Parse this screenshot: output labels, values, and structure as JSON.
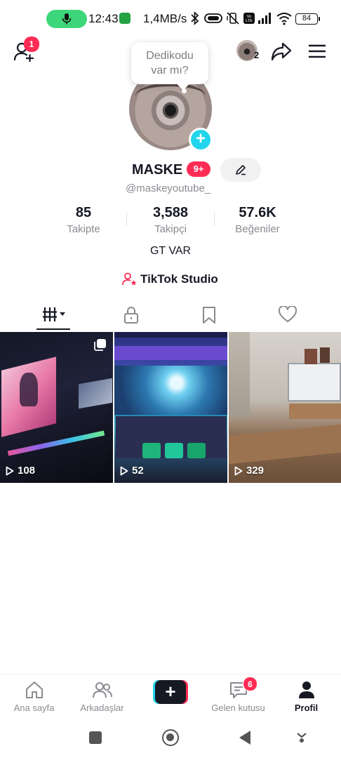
{
  "status_bar": {
    "time": "12:43",
    "network_speed": "1,4MB/s",
    "battery": "84"
  },
  "header": {
    "friends_badge": "1",
    "story_count": "2"
  },
  "profile": {
    "note_bubble_line1": "Dedikodu",
    "note_bubble_line2": "var mı?",
    "username": "MASKE",
    "notification_badge": "9+",
    "handle": "@maskeyoutube_",
    "stats": [
      {
        "value": "85",
        "label": "Takipte"
      },
      {
        "value": "3,588",
        "label": "Takipçi"
      },
      {
        "value": "57.6K",
        "label": "Beğeniler"
      }
    ],
    "bio": "GT VAR",
    "studio_link": "TikTok Studio"
  },
  "tabs": [
    {
      "name": "videos",
      "icon": "grid-icon",
      "active": true
    },
    {
      "name": "private",
      "icon": "lock-icon",
      "active": false
    },
    {
      "name": "saved",
      "icon": "bookmark-icon",
      "active": false
    },
    {
      "name": "liked",
      "icon": "heart-icon",
      "active": false
    }
  ],
  "videos": [
    {
      "views": "108"
    },
    {
      "views": "52"
    },
    {
      "views": "329"
    }
  ],
  "bottom_nav": [
    {
      "label": "Ana sayfa",
      "icon": "home-icon"
    },
    {
      "label": "Arkadaşlar",
      "icon": "friends-icon"
    },
    {
      "label": "",
      "icon": "create-plus-icon"
    },
    {
      "label": "Gelen kutusu",
      "icon": "inbox-icon",
      "badge": "6"
    },
    {
      "label": "Profil",
      "icon": "profile-icon",
      "active": true
    }
  ],
  "colors": {
    "accent_red": "#fe2c55",
    "accent_cyan": "#20d5ec",
    "text_primary": "#161823",
    "text_secondary": "#8a8b91"
  }
}
